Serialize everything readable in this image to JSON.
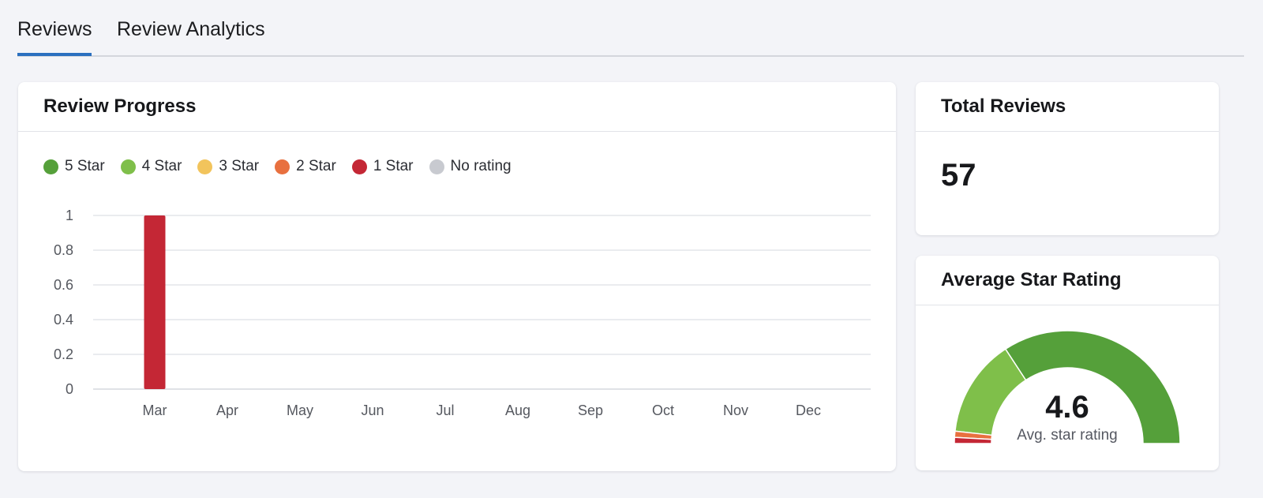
{
  "tabs": [
    {
      "label": "Reviews",
      "active": true
    },
    {
      "label": "Review Analytics",
      "active": false
    }
  ],
  "review_progress": {
    "title": "Review Progress",
    "legend": [
      {
        "label": "5 Star",
        "color": "#55a03a"
      },
      {
        "label": "4 Star",
        "color": "#7fbf4a"
      },
      {
        "label": "3 Star",
        "color": "#f2c45c"
      },
      {
        "label": "2 Star",
        "color": "#e8703f"
      },
      {
        "label": "1 Star",
        "color": "#c42735"
      },
      {
        "label": "No rating",
        "color": "#c8cad0"
      }
    ]
  },
  "total_reviews": {
    "title": "Total Reviews",
    "value": "57"
  },
  "average_rating": {
    "title": "Average Star Rating",
    "value": "4.6",
    "caption": "Avg. star rating"
  },
  "chart_data": [
    {
      "type": "bar",
      "title": "Review Progress",
      "categories": [
        "Mar",
        "Apr",
        "May",
        "Jun",
        "Jul",
        "Aug",
        "Sep",
        "Oct",
        "Nov",
        "Dec"
      ],
      "series": [
        {
          "name": "5 Star",
          "color": "#55a03a",
          "values": [
            0,
            0,
            0,
            0,
            0,
            0,
            0,
            0,
            0,
            0
          ]
        },
        {
          "name": "4 Star",
          "color": "#7fbf4a",
          "values": [
            0,
            0,
            0,
            0,
            0,
            0,
            0,
            0,
            0,
            0
          ]
        },
        {
          "name": "3 Star",
          "color": "#f2c45c",
          "values": [
            0,
            0,
            0,
            0,
            0,
            0,
            0,
            0,
            0,
            0
          ]
        },
        {
          "name": "2 Star",
          "color": "#e8703f",
          "values": [
            0,
            0,
            0,
            0,
            0,
            0,
            0,
            0,
            0,
            0
          ]
        },
        {
          "name": "1 Star",
          "color": "#c42735",
          "values": [
            1,
            0,
            0,
            0,
            0,
            0,
            0,
            0,
            0,
            0
          ]
        },
        {
          "name": "No rating",
          "color": "#c8cad0",
          "values": [
            0,
            0,
            0,
            0,
            0,
            0,
            0,
            0,
            0,
            0
          ]
        }
      ],
      "yticks": [
        "0",
        "0.2",
        "0.4",
        "0.6",
        "0.8",
        "1"
      ],
      "ylim": [
        0,
        1
      ],
      "xlabel": "",
      "ylabel": "",
      "grid": true,
      "legend": "top-left"
    },
    {
      "type": "pie",
      "title": "Average Star Rating",
      "variant": "semi-donut",
      "slices": [
        {
          "name": "1 Star",
          "color": "#c42735",
          "value": 1
        },
        {
          "name": "2 Star",
          "color": "#e8703f",
          "value": 1
        },
        {
          "name": "3 Star",
          "color": "#f2c45c",
          "value": 0
        },
        {
          "name": "4 Star",
          "color": "#7fbf4a",
          "value": 16
        },
        {
          "name": "5 Star",
          "color": "#55a03a",
          "value": 39
        }
      ],
      "center_value": "4.6",
      "center_caption": "Avg. star rating"
    }
  ]
}
